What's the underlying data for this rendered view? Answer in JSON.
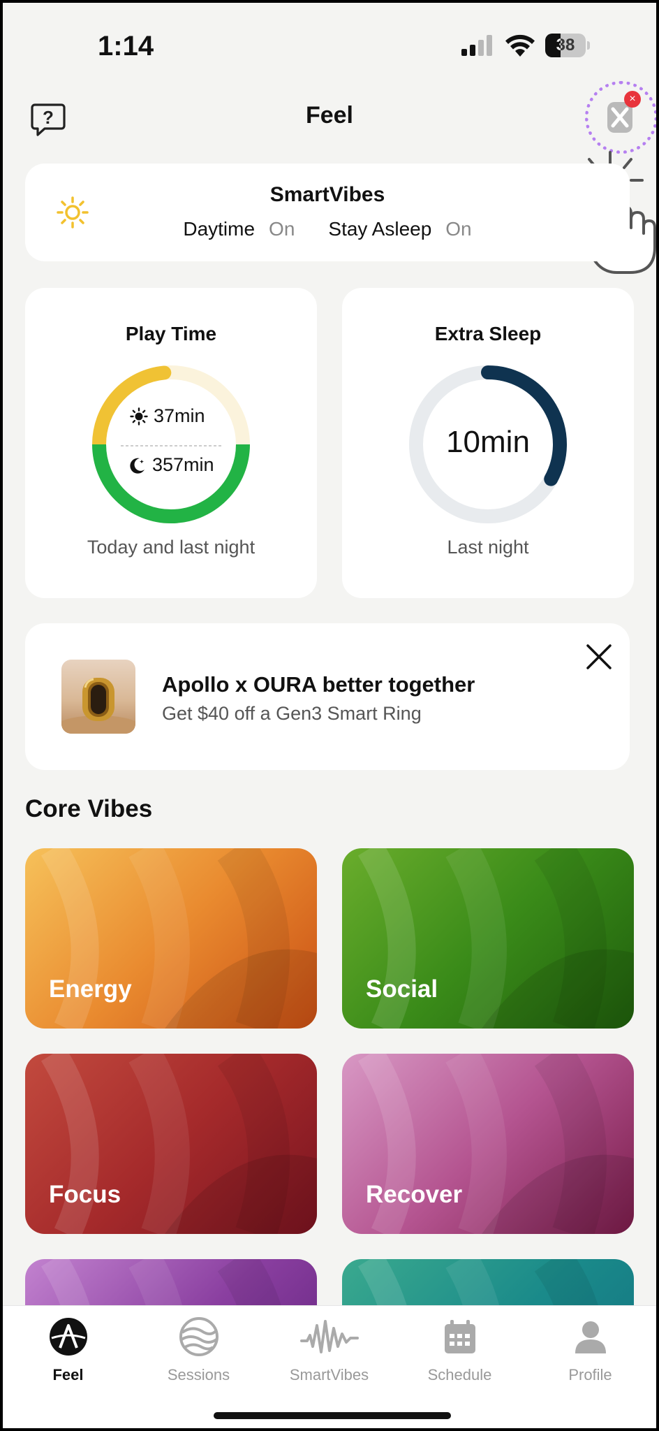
{
  "status_bar": {
    "time": "1:14",
    "battery": "38"
  },
  "header": {
    "title": "Feel",
    "help_icon": "help-bubble-icon",
    "device_icon": "device-icon",
    "device_badge": "×"
  },
  "smartvibes": {
    "title": "SmartVibes",
    "items": [
      {
        "label": "Daytime",
        "value": "On"
      },
      {
        "label": "Stay Asleep",
        "value": "On"
      }
    ],
    "icon_color": "#f2c12e"
  },
  "play_time": {
    "title": "Play Time",
    "day_value": "37min",
    "night_value": "357min",
    "caption": "Today and last night",
    "day_fraction": 0.094,
    "night_fraction": 0.5,
    "colors": {
      "day": "#f0c234",
      "day_track": "#fbf3dc",
      "night": "#22b345"
    }
  },
  "extra_sleep": {
    "title": "Extra Sleep",
    "value": "10min",
    "caption": "Last night",
    "fraction": 0.3,
    "colors": {
      "arc": "#0f3350",
      "track": "#e8ebee"
    }
  },
  "promo": {
    "title": "Apollo x OURA better together",
    "subtitle": "Get $40 off a Gen3 Smart Ring"
  },
  "core_vibes": {
    "title": "Core Vibes",
    "items": [
      {
        "label": "Energy",
        "colors": [
          "#f6c15a",
          "#e98a2f",
          "#c94f14"
        ]
      },
      {
        "label": "Social",
        "colors": [
          "#6aad2c",
          "#3a8b19",
          "#1f5e0c"
        ]
      },
      {
        "label": "Focus",
        "colors": [
          "#c24a3e",
          "#a52a2b",
          "#7a1420"
        ]
      },
      {
        "label": "Recover",
        "colors": [
          "#d898c4",
          "#b45490",
          "#7a1c4a"
        ]
      },
      {
        "label": "",
        "colors": [
          "#c282cf",
          "#8a3fa0",
          "#5e1f7a"
        ]
      },
      {
        "label": "",
        "colors": [
          "#3aa98e",
          "#1a8a8a",
          "#126f80"
        ]
      }
    ]
  },
  "tabs": [
    {
      "label": "Feel",
      "icon": "apollo-logo-icon",
      "active": true
    },
    {
      "label": "Sessions",
      "icon": "sessions-icon",
      "active": false
    },
    {
      "label": "SmartVibes",
      "icon": "waveform-icon",
      "active": false
    },
    {
      "label": "Schedule",
      "icon": "calendar-icon",
      "active": false
    },
    {
      "label": "Profile",
      "icon": "person-icon",
      "active": false
    }
  ]
}
